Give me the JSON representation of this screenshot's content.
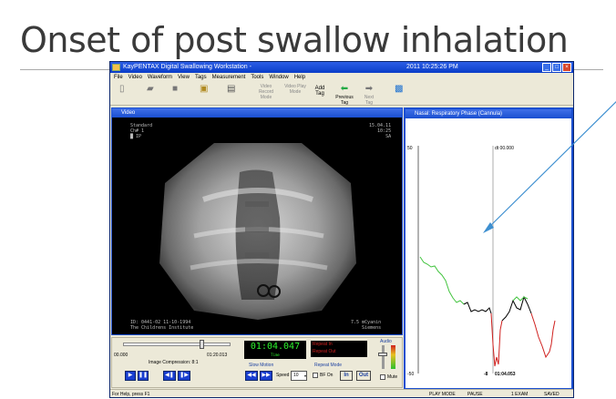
{
  "slide": {
    "title": "Onset of post swallow inhalation"
  },
  "window": {
    "title": "KayPENTAX Digital Swallowing Workstation -",
    "clock": "2011 10:25:26 PM",
    "controls": [
      "_",
      "□",
      "×"
    ]
  },
  "menu": [
    "File",
    "Video",
    "Waveform",
    "View",
    "Tags",
    "Measurement",
    "Tools",
    "Window",
    "Help"
  ],
  "toolbar": {
    "video_record": "Video Record Mode",
    "video_play": "Video Play Mode",
    "add_tag": "Add Tag",
    "previous_tag": "Previous Tag",
    "next_tag": "Next Tag"
  },
  "video": {
    "header": "Video",
    "overlay_tl": [
      "Standard",
      "Ch# 1",
      "█ IP"
    ],
    "overlay_tr": [
      "15.04.11",
      "10:25",
      "SA"
    ],
    "overlay_bl": [
      "ID: 0441-02 11-10-1994",
      "The Childrens Institute"
    ],
    "overlay_br": [
      "7.5 mCyanin",
      "Siemens"
    ]
  },
  "respiratory": {
    "header": "Nasal: Respiratory Phase (Cannula)",
    "y_top": "50",
    "y_bottom": "-50",
    "cursor_label": "dt 00.000",
    "time_label": "01:04.053",
    "time_prefix": "-8"
  },
  "controls": {
    "start_time": "00.000",
    "end_time": "01:20.013",
    "compression": "Image Compression: 8:1",
    "lcd_time": "01:04.047",
    "lcd_caption": "Time",
    "repeat_in": "Repeat In",
    "repeat_out": "Repeat Out",
    "slow_motion": "Slow Motion",
    "repeat_mode": "Repeat Mode",
    "speed_label": "Speed",
    "speed_value": "10",
    "bf_label": "BF On",
    "in_label": "In",
    "out_label": "Out",
    "audio_label": "Audio",
    "mute_label": "Mute"
  },
  "status": {
    "help": "For Help, press F1",
    "mode": "PLAY MODE",
    "pause": "PAUSE",
    "exam": "1 EXAM",
    "saved": "SAVED"
  }
}
